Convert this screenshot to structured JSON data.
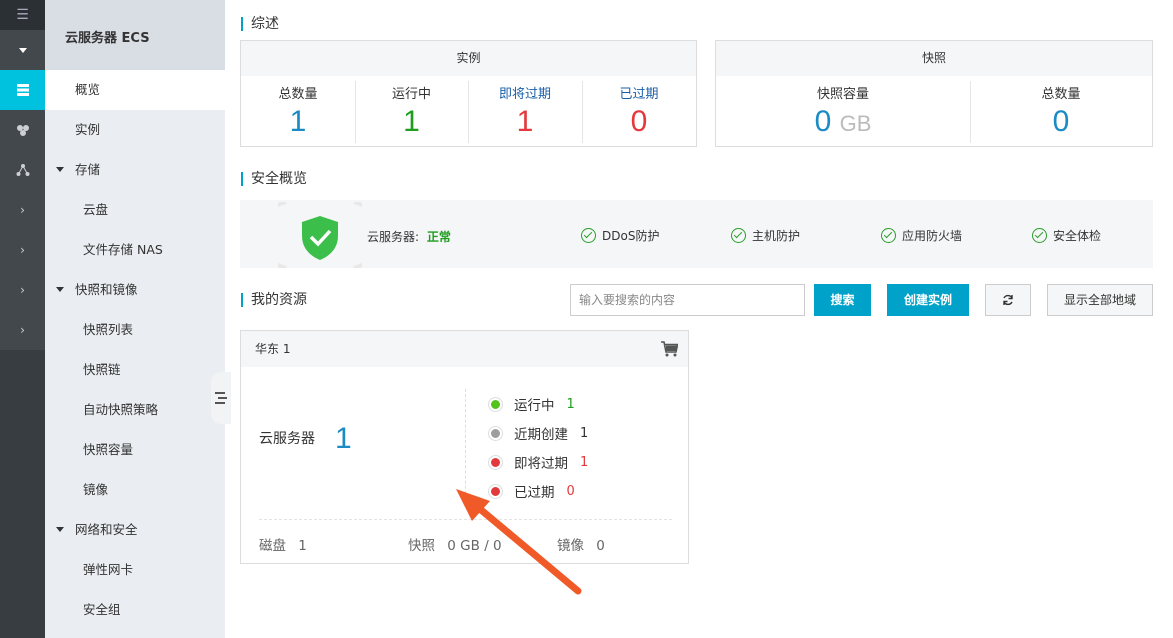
{
  "rail": {
    "menu_icon": "menu-icon",
    "active_icon": "server-icon"
  },
  "sidebar": {
    "title": "云服务器 ECS",
    "items": [
      {
        "label": "概览"
      },
      {
        "label": "实例"
      },
      {
        "label": "存储"
      },
      {
        "label": "云盘"
      },
      {
        "label": "文件存储 NAS"
      },
      {
        "label": "快照和镜像"
      },
      {
        "label": "快照列表"
      },
      {
        "label": "快照链"
      },
      {
        "label": "自动快照策略"
      },
      {
        "label": "快照容量"
      },
      {
        "label": "镜像"
      },
      {
        "label": "网络和安全"
      },
      {
        "label": "弹性网卡"
      },
      {
        "label": "安全组"
      }
    ]
  },
  "overview": {
    "title": "综述",
    "instances": {
      "header": "实例",
      "stats": [
        {
          "label": "总数量",
          "value": "1",
          "label_color": "#333333",
          "value_color": "#1a8bc4"
        },
        {
          "label": "运行中",
          "value": "1",
          "label_color": "#333333",
          "value_color": "#1f9d1f"
        },
        {
          "label": "即将过期",
          "value": "1",
          "label_color": "#1a5ea8",
          "value_color": "#e4393c"
        },
        {
          "label": "已过期",
          "value": "0",
          "label_color": "#1a5ea8",
          "value_color": "#e4393c"
        }
      ]
    },
    "snapshots": {
      "header": "快照",
      "capacity_label": "快照容量",
      "capacity_value": "0",
      "capacity_unit": "GB",
      "count_label": "总数量",
      "count_value": "0"
    }
  },
  "security": {
    "title": "安全概览",
    "server_label": "云服务器:",
    "server_status": "正常",
    "checks": [
      "DDoS防护",
      "主机防护",
      "应用防火墙",
      "安全体检"
    ]
  },
  "resources": {
    "title": "我的资源",
    "search_placeholder": "输入要搜索的内容",
    "search_button": "搜索",
    "create_button": "创建实例",
    "show_all_button": "显示全部地域",
    "region": {
      "name": "华东 1",
      "server_label": "云服务器",
      "server_count": "1",
      "statuses": [
        {
          "label": "运行中",
          "value": "1",
          "dot_color": "#52c41a",
          "value_color": "#1f9d1f"
        },
        {
          "label": "近期创建",
          "value": "1",
          "dot_color": "#9e9e9e",
          "value_color": "#333333"
        },
        {
          "label": "即将过期",
          "value": "1",
          "dot_color": "#e4393c",
          "value_color": "#e4393c"
        },
        {
          "label": "已过期",
          "value": "0",
          "dot_color": "#e4393c",
          "value_color": "#e4393c"
        }
      ],
      "disk_label": "磁盘",
      "disk_value": "1",
      "snapshot_label": "快照",
      "snapshot_value": "0 GB / 0",
      "image_label": "镜像",
      "image_value": "0"
    }
  },
  "colors": {
    "accent": "#00a2ca",
    "rail": "#373d41",
    "rail_active": "#00c1de",
    "annotation_arrow": "#f05a28"
  }
}
